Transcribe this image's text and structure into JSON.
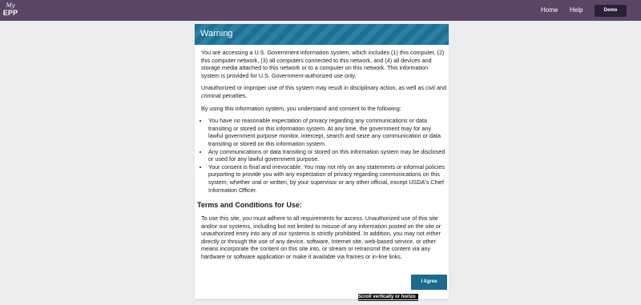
{
  "header": {
    "logo_top": "My",
    "logo_bottom": "EPP",
    "nav": {
      "home": "Home",
      "help": "Help"
    },
    "demo_button": "Demo"
  },
  "warning": {
    "title": "Warning",
    "paragraphs": [
      "You are accessing a U.S. Government information system, which includes (1) this computer, (2) this computer network, (3) all computers connected to this network, and (4) all devices and storage media attached to this network or to a computer on this network. This information system is provided for U.S. Government-authorized use only.",
      "Unauthorized or improper use of this system may result in disciplinary action, as well as civil and criminal penalties.",
      "By using this information system, you understand and consent to the following:"
    ],
    "bullets": [
      "You have no reasonable expectation of privacy regarding any communications or data transiting or stored on this information system. At any time, the government may for any lawful government purpose monitor, intercept, search and seize any communication or data transiting or stored on this information system.",
      "Any communications or data transiting or stored on this information system may be disclosed or used for any lawful government purpose.",
      "Your consent is final and irrevocable. You may not rely on any statements or informal policies purporting to provide you with any expectation of privacy regarding communications on this system, whether oral or written, by your supervisor or any other official, except USDA's Chief Information Officer."
    ]
  },
  "terms": {
    "heading": "Terms and Conditions for Use:",
    "text": "To use this site, you must adhere to all requirements for access. Unauthorized use of this site and/or our systems, including but not limited to misuse of any information posted on the site or unauthorized entry into any of our systems is strictly prohibited. In addition, you may not either directly or through the use of any device, software, Internet site, web-based service, or other means incorporate the content on this site into, or stream or retransmit the content via any hardware or software application or make it available via frames or in-line links."
  },
  "agree_button": "I Agree",
  "scroll_hint": "Scroll vertically or horizo"
}
